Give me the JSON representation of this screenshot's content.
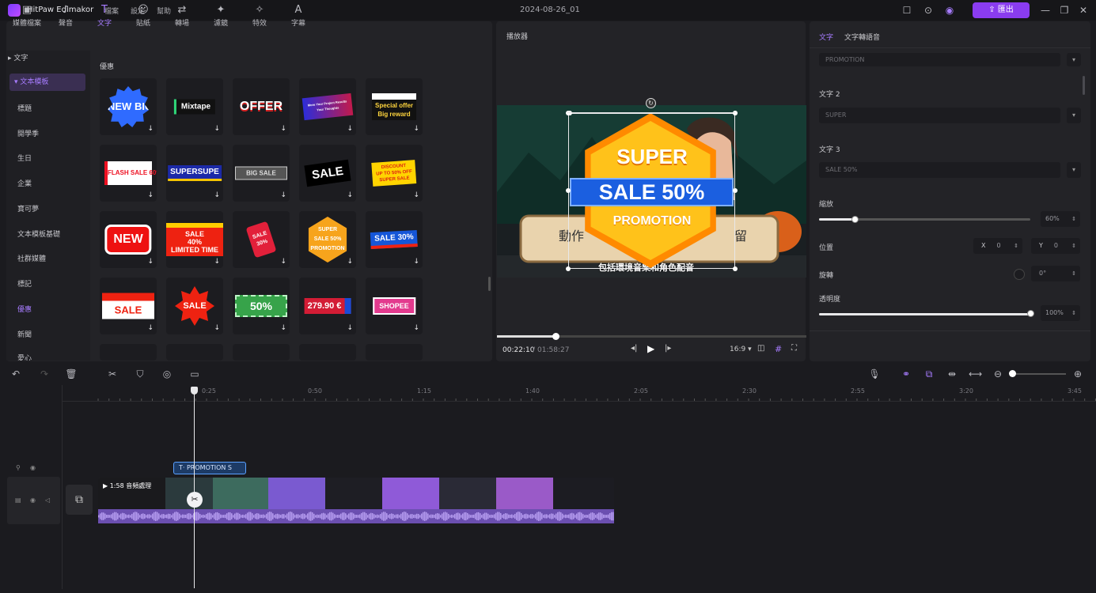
{
  "app": {
    "name": "HitPaw Edimakor",
    "project": "2024-08-26_01",
    "menu": [
      "檔案",
      "設定",
      "幫助"
    ],
    "export_label": "匯出"
  },
  "tool_tabs": [
    "媒體檔案",
    "聲音",
    "文字",
    "貼紙",
    "轉場",
    "濾鏡",
    "特效",
    "字幕"
  ],
  "categories": {
    "text_header": "文字",
    "template_header": "文本模板",
    "items": [
      "標題",
      "開學季",
      "生日",
      "企業",
      "寶可夢",
      "文本模板基礎",
      "社群媒體",
      "標記",
      "優惠",
      "新聞",
      "愛心"
    ]
  },
  "grid": {
    "label": "優惠",
    "tiles": [
      [
        "NEW\nBIG OFFER",
        "Mixtape",
        "OFFER",
        "More Your Project Results Your Thoughts",
        "Special offer\nBig reward"
      ],
      [
        "FLASH SALE 60%",
        "SUPERSUPE",
        "BIG SALE",
        "SALE",
        "DISCOUNT\nUP TO 50% OFF\nSUPER SALE"
      ],
      [
        "NEW",
        "SALE\n40%\nLIMITED TIME",
        "SALE 30%",
        "SUPER\nSALE 50%\nPROMOTION",
        "SALE 30%"
      ],
      [
        "SALE",
        "SALE",
        "50%",
        "279.90 €",
        "SHOPEE"
      ]
    ]
  },
  "player": {
    "title": "播放器",
    "overlay": {
      "line1": "SUPER",
      "line2": "SALE 50%",
      "line3": "PROMOTION"
    },
    "subtitle_top": "動作",
    "subtitle_right": "留",
    "subtitle_bottom": "包括環境音樂和角色配音",
    "time_current": "00:22:10",
    "time_total": "01:58:27",
    "progress": 0.19,
    "aspect": "16:9"
  },
  "props": {
    "tabs": [
      "文字",
      "文字轉語音"
    ],
    "text1_value": "PROMOTION",
    "text2_label": "文字 2",
    "text2_value": "SUPER",
    "text3_label": "文字 3",
    "text3_value": "SALE 50%",
    "scale_label": "縮放",
    "scale_value": "60%",
    "scale_fraction": 0.17,
    "position_label": "位置",
    "pos_x_label": "X",
    "pos_x_value": "0",
    "pos_y_label": "Y",
    "pos_y_value": "0",
    "rotation_label": "旋轉",
    "rotation_value": "0°",
    "opacity_label": "透明度",
    "opacity_value": "100%",
    "opacity_fraction": 1.0
  },
  "timeline": {
    "ruler": [
      "0:25",
      "0:50",
      "1:15",
      "1:40",
      "2:05",
      "2:30",
      "2:55",
      "3:20",
      "3:45"
    ],
    "text_clip": "PROMOTION S",
    "video_clip_label": "1:58 音頻處理"
  }
}
